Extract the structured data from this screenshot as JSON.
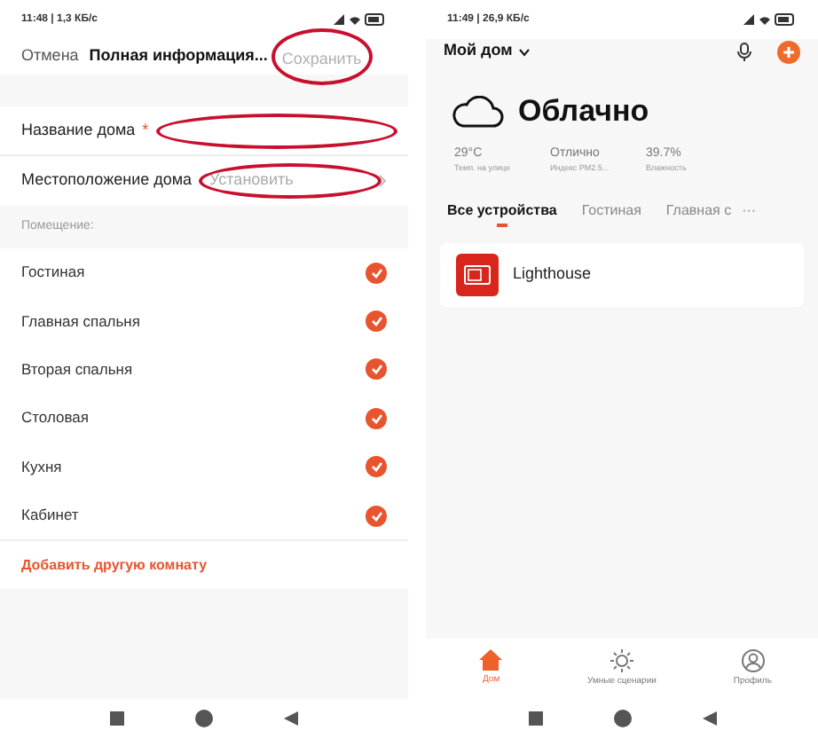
{
  "left_screen": {
    "status_bar": {
      "text": "11:48 | 1,3 КБ/с"
    },
    "header": {
      "cancel": "Отмена",
      "title": "Полная информация...",
      "save": "Сохранить"
    },
    "fields": [
      {
        "label": "Название дома",
        "required_mark": "*",
        "annotated": true
      },
      {
        "label": "Местоположение дома",
        "placeholder": "Установить",
        "annotated": true
      }
    ],
    "section_title": "Помещение:",
    "rooms": [
      {
        "name": "Гостиная",
        "checked": true
      },
      {
        "name": "Главная спальня",
        "checked": true
      },
      {
        "name": "Вторая спальня",
        "checked": true
      },
      {
        "name": "Столовая",
        "checked": true
      },
      {
        "name": "Кухня",
        "checked": true
      },
      {
        "name": "Кабинет",
        "checked": true
      }
    ],
    "add_room": "Добавить другую комнату"
  },
  "right_screen": {
    "status_bar": {
      "text": "11:49 | 26,9 КБ/с"
    },
    "home_name": "Мой дом",
    "weather": {
      "condition": "Облачно",
      "stats": [
        {
          "value": "29°C",
          "label": "Темп. на улице"
        },
        {
          "value": "Отлично",
          "label": "Индекс PM2.5..."
        },
        {
          "value": "39.7%",
          "label": "Влажность"
        }
      ]
    },
    "tabs": [
      {
        "label": "Все устройства",
        "selected": true
      },
      {
        "label": "Гостиная",
        "selected": false
      },
      {
        "label": "Главная с",
        "selected": false
      }
    ],
    "more": "···",
    "devices": [
      {
        "name": "Lighthouse"
      }
    ],
    "bottom_nav": [
      {
        "label": "Дом",
        "kind": "home",
        "selected": true
      },
      {
        "label": "Умные сценарии",
        "kind": "scenes",
        "selected": false
      },
      {
        "label": "Профиль",
        "kind": "profile",
        "selected": false
      }
    ]
  }
}
